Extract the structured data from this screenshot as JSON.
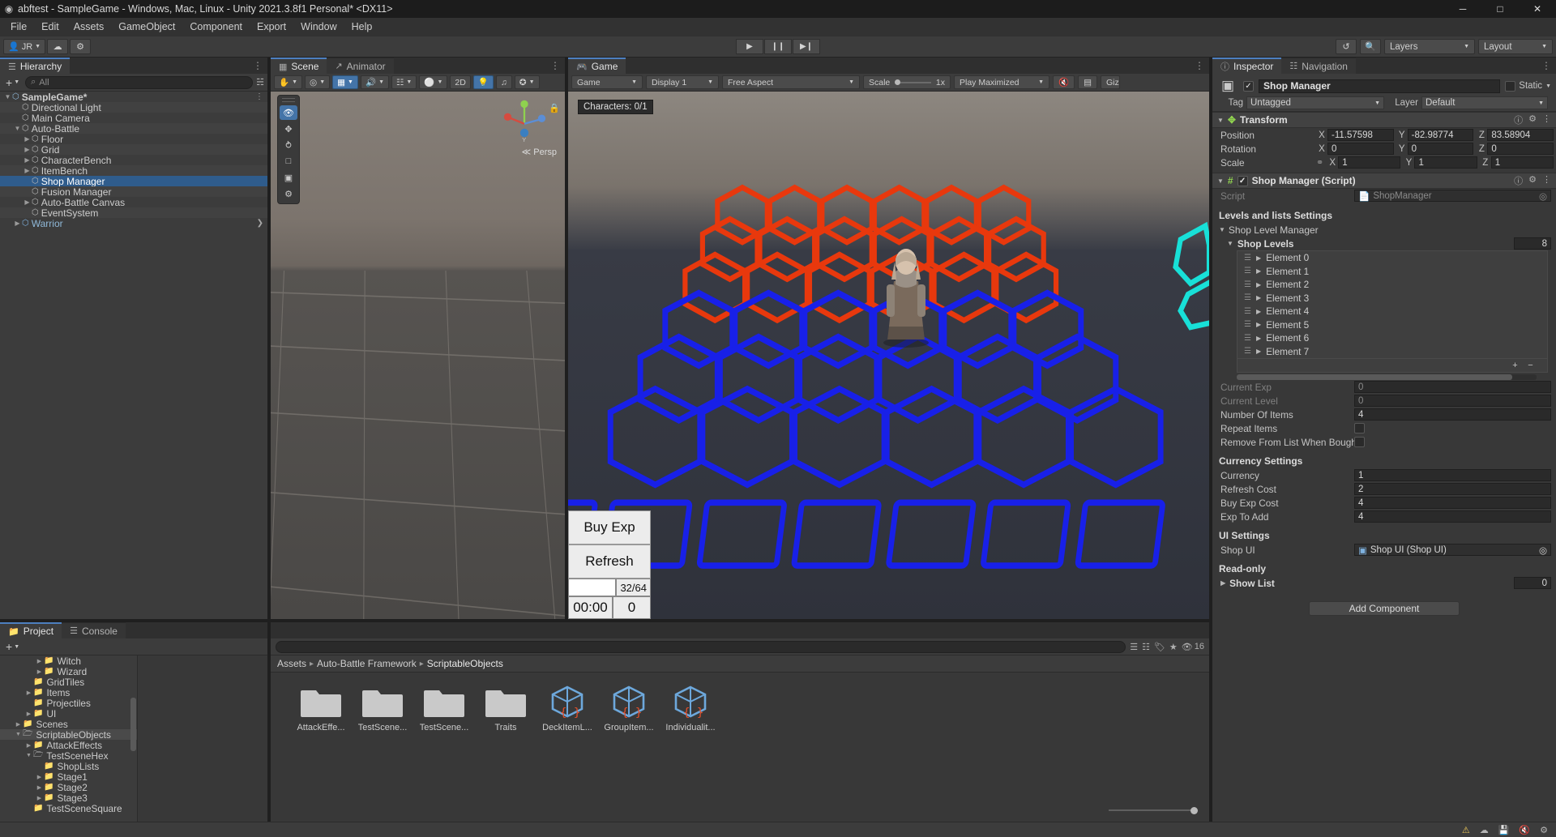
{
  "window": {
    "title": "abftest - SampleGame - Windows, Mac, Linux - Unity 2021.3.8f1 Personal* <DX11>",
    "minimize": "─",
    "maximize": "□",
    "close": "✕"
  },
  "menu": [
    "File",
    "Edit",
    "Assets",
    "GameObject",
    "Component",
    "Export",
    "Window",
    "Help"
  ],
  "toolbar": {
    "account": "JR",
    "cloud_icon": "cloud-icon",
    "collab_icon": "collab-icon",
    "play": "▶",
    "pause": "❙❙",
    "step": "▶❙",
    "undo_history_icon": "undo-history-icon",
    "search_icon": "search-icon",
    "layers": "Layers",
    "layout": "Layout"
  },
  "hierarchy": {
    "tab": "Hierarchy",
    "tab_icon": "hierarchy-icon",
    "add_label": "+",
    "search_placeholder": "All",
    "items": [
      {
        "label": "SampleGame*",
        "depth": 0,
        "icon": "unity-scene-icon",
        "tw": "▼",
        "selected": false,
        "bold": true,
        "more": true
      },
      {
        "label": "Directional Light",
        "depth": 1,
        "icon": "gameobject-icon",
        "tw": "",
        "selected": false
      },
      {
        "label": "Main Camera",
        "depth": 1,
        "icon": "gameobject-icon",
        "tw": "",
        "selected": false
      },
      {
        "label": "Auto-Battle",
        "depth": 1,
        "icon": "gameobject-icon",
        "tw": "▼",
        "selected": false
      },
      {
        "label": "Floor",
        "depth": 2,
        "icon": "gameobject-icon",
        "tw": "▶",
        "selected": false
      },
      {
        "label": "Grid",
        "depth": 2,
        "icon": "gameobject-icon",
        "tw": "▶",
        "selected": false
      },
      {
        "label": "CharacterBench",
        "depth": 2,
        "icon": "gameobject-icon",
        "tw": "▶",
        "selected": false
      },
      {
        "label": "ItemBench",
        "depth": 2,
        "icon": "gameobject-icon",
        "tw": "▶",
        "selected": false
      },
      {
        "label": "Shop Manager",
        "depth": 2,
        "icon": "gameobject-icon",
        "tw": "",
        "selected": true
      },
      {
        "label": "Fusion Manager",
        "depth": 2,
        "icon": "gameobject-icon",
        "tw": "",
        "selected": false
      },
      {
        "label": "Auto-Battle Canvas",
        "depth": 2,
        "icon": "gameobject-icon",
        "tw": "▶",
        "selected": false
      },
      {
        "label": "EventSystem",
        "depth": 2,
        "icon": "gameobject-icon",
        "tw": "",
        "selected": false
      },
      {
        "label": "Warrior",
        "depth": 1,
        "icon": "prefab-icon",
        "tw": "▶",
        "selected": false,
        "prefab": true,
        "more": true
      }
    ]
  },
  "scene": {
    "tabs": [
      {
        "label": "Scene",
        "icon": "scene-icon",
        "active": true
      },
      {
        "label": "Animator",
        "icon": "animator-icon",
        "active": false
      }
    ],
    "toolbar": {
      "hand_icon": "hand-tool-icon",
      "pivot": "Pivot",
      "center": "Center",
      "shading": "Shaded",
      "draw_mode": "2D",
      "lighting_icon": "lighting-icon",
      "audio_icon": "audio-icon",
      "fx_icon": "effects-icon",
      "gizmos_icon": "gizmos-icon"
    },
    "persp_label": "Persp",
    "tools": [
      "eye-tool",
      "move-tool",
      "rotate-tool",
      "scale-tool",
      "rect-tool",
      "transform-tool"
    ]
  },
  "game": {
    "tabs": [
      {
        "label": "Game",
        "icon": "game-icon",
        "active": true
      }
    ],
    "toolbar": {
      "display_target": "Game",
      "display": "Display 1",
      "aspect": "Free Aspect",
      "scale_label": "Scale",
      "scale_value": "1x",
      "play_mode": "Play Maximized",
      "mute_icon": "mute-audio-icon",
      "stats_icon": "stats-icon",
      "gizmos_label": "Gizmos"
    },
    "character_counter": "Characters: 0/1",
    "ui": {
      "buy_exp": "Buy Exp",
      "refresh": "Refresh",
      "exp_bar": "32/64",
      "timer": "00:00",
      "gold": "0"
    }
  },
  "inspector": {
    "tabs": [
      {
        "label": "Inspector",
        "icon": "info-icon",
        "active": true
      },
      {
        "label": "Navigation",
        "icon": "navigation-icon",
        "active": false
      }
    ],
    "object_name": "Shop Manager",
    "enabled": true,
    "static_label": "Static",
    "tag_label": "Tag",
    "tag_value": "Untagged",
    "layer_label": "Layer",
    "layer_value": "Default",
    "transform": {
      "title": "Transform",
      "rows": [
        {
          "label": "Position",
          "x": "-11.57598",
          "y": "-82.98774",
          "z": "83.58904",
          "lock": false
        },
        {
          "label": "Rotation",
          "x": "0",
          "y": "0",
          "z": "0",
          "lock": false
        },
        {
          "label": "Scale",
          "x": "1",
          "y": "1",
          "z": "1",
          "lock": true
        }
      ],
      "axes": [
        "X",
        "Y",
        "Z"
      ]
    },
    "script_component": {
      "title": "Shop Manager (Script)",
      "enabled": true,
      "script_label": "Script",
      "script_value": "ShopManager",
      "sections": {
        "levels_header": "Levels and lists Settings",
        "shop_level_manager": "Shop Level Manager",
        "shop_levels_label": "Shop Levels",
        "shop_levels_count": "8",
        "elements": [
          "Element 0",
          "Element 1",
          "Element 2",
          "Element 3",
          "Element 4",
          "Element 5",
          "Element 6",
          "Element 7"
        ],
        "list_add": "+",
        "list_remove": "−"
      },
      "props": [
        {
          "label": "Current Exp",
          "value": "0",
          "dim": true,
          "type": "number"
        },
        {
          "label": "Current Level",
          "value": "0",
          "dim": true,
          "type": "number"
        },
        {
          "label": "Number Of Items",
          "value": "4",
          "dim": false,
          "type": "number"
        },
        {
          "label": "Repeat Items",
          "value": "",
          "dim": false,
          "type": "checkbox"
        },
        {
          "label": "Remove From List When Bought",
          "value": "",
          "dim": false,
          "type": "checkbox"
        }
      ],
      "currency_header": "Currency Settings",
      "currency_props": [
        {
          "label": "Currency",
          "value": "1"
        },
        {
          "label": "Refresh Cost",
          "value": "2"
        },
        {
          "label": "Buy Exp Cost",
          "value": "4"
        },
        {
          "label": "Exp To Add",
          "value": "4"
        }
      ],
      "ui_header": "UI Settings",
      "ui_prop": {
        "label": "Shop UI",
        "value": "Shop UI (Shop UI)"
      },
      "readonly_header": "Read-only",
      "show_list": {
        "label": "Show List",
        "value": "0"
      }
    },
    "add_component": "Add Component"
  },
  "project": {
    "tabs": [
      {
        "label": "Project",
        "icon": "folder-icon",
        "active": true
      },
      {
        "label": "Console",
        "icon": "console-icon",
        "active": false
      }
    ],
    "add_label": "+",
    "search_placeholder": "",
    "badge_count": "16",
    "tree": [
      {
        "label": "Witch",
        "depth": 3,
        "tw": "▶",
        "open": false
      },
      {
        "label": "Wizard",
        "depth": 3,
        "tw": "▶",
        "open": false
      },
      {
        "label": "GridTiles",
        "depth": 2,
        "tw": "",
        "open": false
      },
      {
        "label": "Items",
        "depth": 2,
        "tw": "▶",
        "open": false
      },
      {
        "label": "Projectiles",
        "depth": 2,
        "tw": "",
        "open": false
      },
      {
        "label": "UI",
        "depth": 2,
        "tw": "▶",
        "open": false
      },
      {
        "label": "Scenes",
        "depth": 1,
        "tw": "▶",
        "open": false
      },
      {
        "label": "ScriptableObjects",
        "depth": 1,
        "tw": "▼",
        "open": true,
        "selected": true
      },
      {
        "label": "AttackEffects",
        "depth": 2,
        "tw": "▶",
        "open": false
      },
      {
        "label": "TestSceneHex",
        "depth": 2,
        "tw": "▼",
        "open": true
      },
      {
        "label": "ShopLists",
        "depth": 3,
        "tw": "",
        "open": false
      },
      {
        "label": "Stage1",
        "depth": 3,
        "tw": "▶",
        "open": false
      },
      {
        "label": "Stage2",
        "depth": 3,
        "tw": "▶",
        "open": false
      },
      {
        "label": "Stage3",
        "depth": 3,
        "tw": "▶",
        "open": false
      },
      {
        "label": "TestSceneSquare",
        "depth": 2,
        "tw": "",
        "open": false
      }
    ],
    "breadcrumb": [
      "Assets",
      "Auto-Battle Framework",
      "ScriptableObjects"
    ],
    "assets": [
      {
        "name": "AttackEffe...",
        "type": "folder"
      },
      {
        "name": "TestScene...",
        "type": "folder"
      },
      {
        "name": "TestScene...",
        "type": "folder"
      },
      {
        "name": "Traits",
        "type": "folder"
      },
      {
        "name": "DeckItemL...",
        "type": "scriptable"
      },
      {
        "name": "GroupItem...",
        "type": "scriptable"
      },
      {
        "name": "Individualit...",
        "type": "scriptable"
      }
    ]
  },
  "statusbar": {
    "items": [
      "collab-icon",
      "cloud-icon",
      "warning-icon",
      "mute-icon",
      "settings-icon"
    ]
  }
}
